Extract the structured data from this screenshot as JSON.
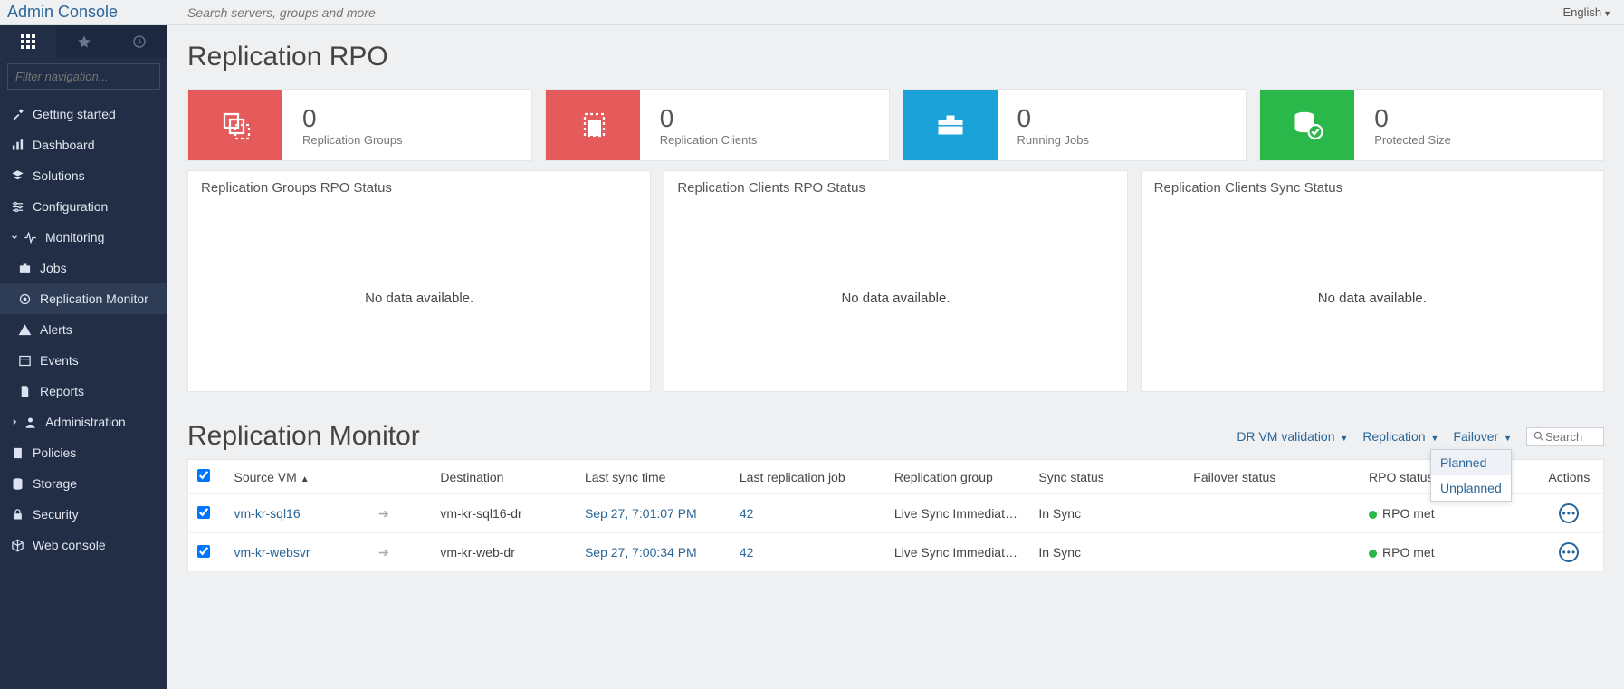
{
  "app_title": "Admin Console",
  "top_search_placeholder": "Search servers, groups and more",
  "language_label": "English",
  "nav_filter_placeholder": "Filter navigation...",
  "nav": {
    "getting_started": "Getting started",
    "dashboard": "Dashboard",
    "solutions": "Solutions",
    "configuration": "Configuration",
    "monitoring": "Monitoring",
    "jobs": "Jobs",
    "replication_monitor": "Replication Monitor",
    "alerts": "Alerts",
    "events": "Events",
    "reports": "Reports",
    "administration": "Administration",
    "policies": "Policies",
    "storage": "Storage",
    "security": "Security",
    "web_console": "Web console"
  },
  "rpo_title": "Replication RPO",
  "kpis": [
    {
      "value": "0",
      "label": "Replication Groups",
      "color": "bg-red",
      "icon": "stack-icon"
    },
    {
      "value": "0",
      "label": "Replication Clients",
      "color": "bg-red",
      "icon": "server-icon"
    },
    {
      "value": "0",
      "label": "Running Jobs",
      "color": "bg-blue",
      "icon": "briefcase-icon"
    },
    {
      "value": "0",
      "label": "Protected Size",
      "color": "bg-green",
      "icon": "db-check-icon"
    }
  ],
  "panels": [
    {
      "title": "Replication Groups RPO Status",
      "message": "No data available."
    },
    {
      "title": "Replication Clients RPO Status",
      "message": "No data available."
    },
    {
      "title": "Replication Clients Sync Status",
      "message": "No data available."
    }
  ],
  "monitor_title": "Replication Monitor",
  "monitor_actions": {
    "dr_validation": "DR VM validation",
    "replication": "Replication",
    "failover": "Failover",
    "failover_options": {
      "planned": "Planned",
      "unplanned": "Unplanned"
    },
    "search_placeholder": "Search"
  },
  "table": {
    "headers": {
      "source_vm": "Source VM",
      "destination": "Destination",
      "last_sync": "Last sync time",
      "last_job": "Last replication job",
      "group": "Replication group",
      "sync_status": "Sync status",
      "failover_status": "Failover status",
      "rpo_status": "RPO status",
      "actions": "Actions"
    },
    "rows": [
      {
        "source_vm": "vm-kr-sql16",
        "destination": "vm-kr-sql16-dr",
        "last_sync": "Sep 27, 7:01:07 PM",
        "last_job": "42",
        "group": "Live Sync Immediat…",
        "sync_status": "In Sync",
        "failover_status": "",
        "rpo_status": "RPO met"
      },
      {
        "source_vm": "vm-kr-websvr",
        "destination": "vm-kr-web-dr",
        "last_sync": "Sep 27, 7:00:34 PM",
        "last_job": "42",
        "group": "Live Sync Immediat…",
        "sync_status": "In Sync",
        "failover_status": "",
        "rpo_status": "RPO met"
      }
    ]
  }
}
